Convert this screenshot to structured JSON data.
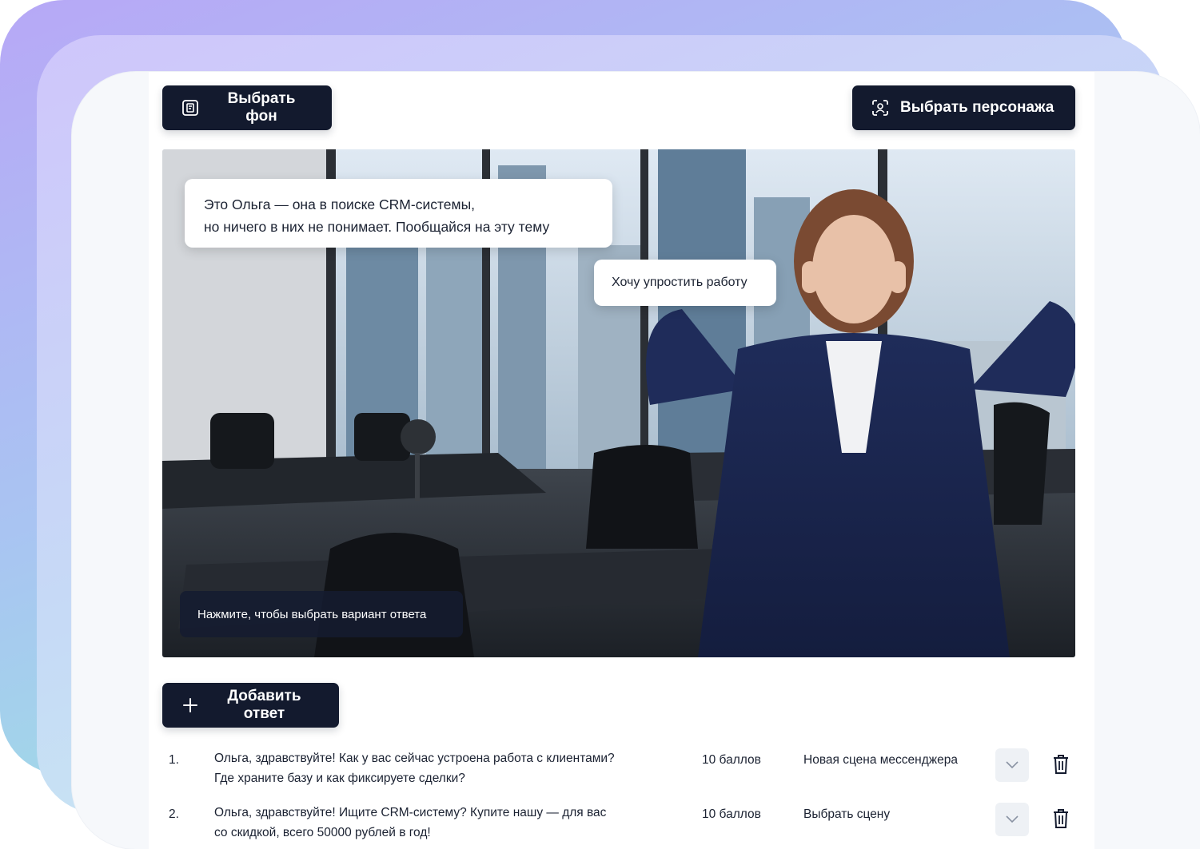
{
  "toolbar": {
    "select_background_label": "Выбрать фон",
    "select_character_label": "Выбрать персонажа"
  },
  "scene": {
    "speech_line1": "Это Ольга — она в поиске CRM-системы,",
    "speech_line2": "но ничего в них не понимает. Пообщайся на эту тему",
    "answer_bubble": "Хочу упростить работу",
    "hint": "Нажмите, чтобы выбрать вариант ответа"
  },
  "add_answer_label": "Добавить ответ",
  "answers": [
    {
      "number": "1.",
      "line1": "Ольга, здравствуйте! Как у вас сейчас устроена работа с клиентами?",
      "line2": "Где храните базу и как фиксируете сделки?",
      "score": "10 баллов",
      "scene": "Новая сцена мессенджера"
    },
    {
      "number": "2.",
      "line1": "Ольга, здравствуйте! Ищите CRM-систему? Купите нашу — для вас",
      "line2": "со скидкой, всего 50000 рублей в год!",
      "score": "10 баллов",
      "scene": "Выбрать сцену"
    }
  ],
  "icons": {
    "background": "image-frame-icon",
    "character": "character-frame-icon",
    "add": "plus-icon",
    "dropdown": "chevron-down-icon",
    "delete": "trash-icon"
  },
  "colors": {
    "dark_button": "#131a2e",
    "card_background": "#f6f8fb",
    "gradient_start": "#b7a8f6",
    "gradient_end": "#9ee8df"
  }
}
